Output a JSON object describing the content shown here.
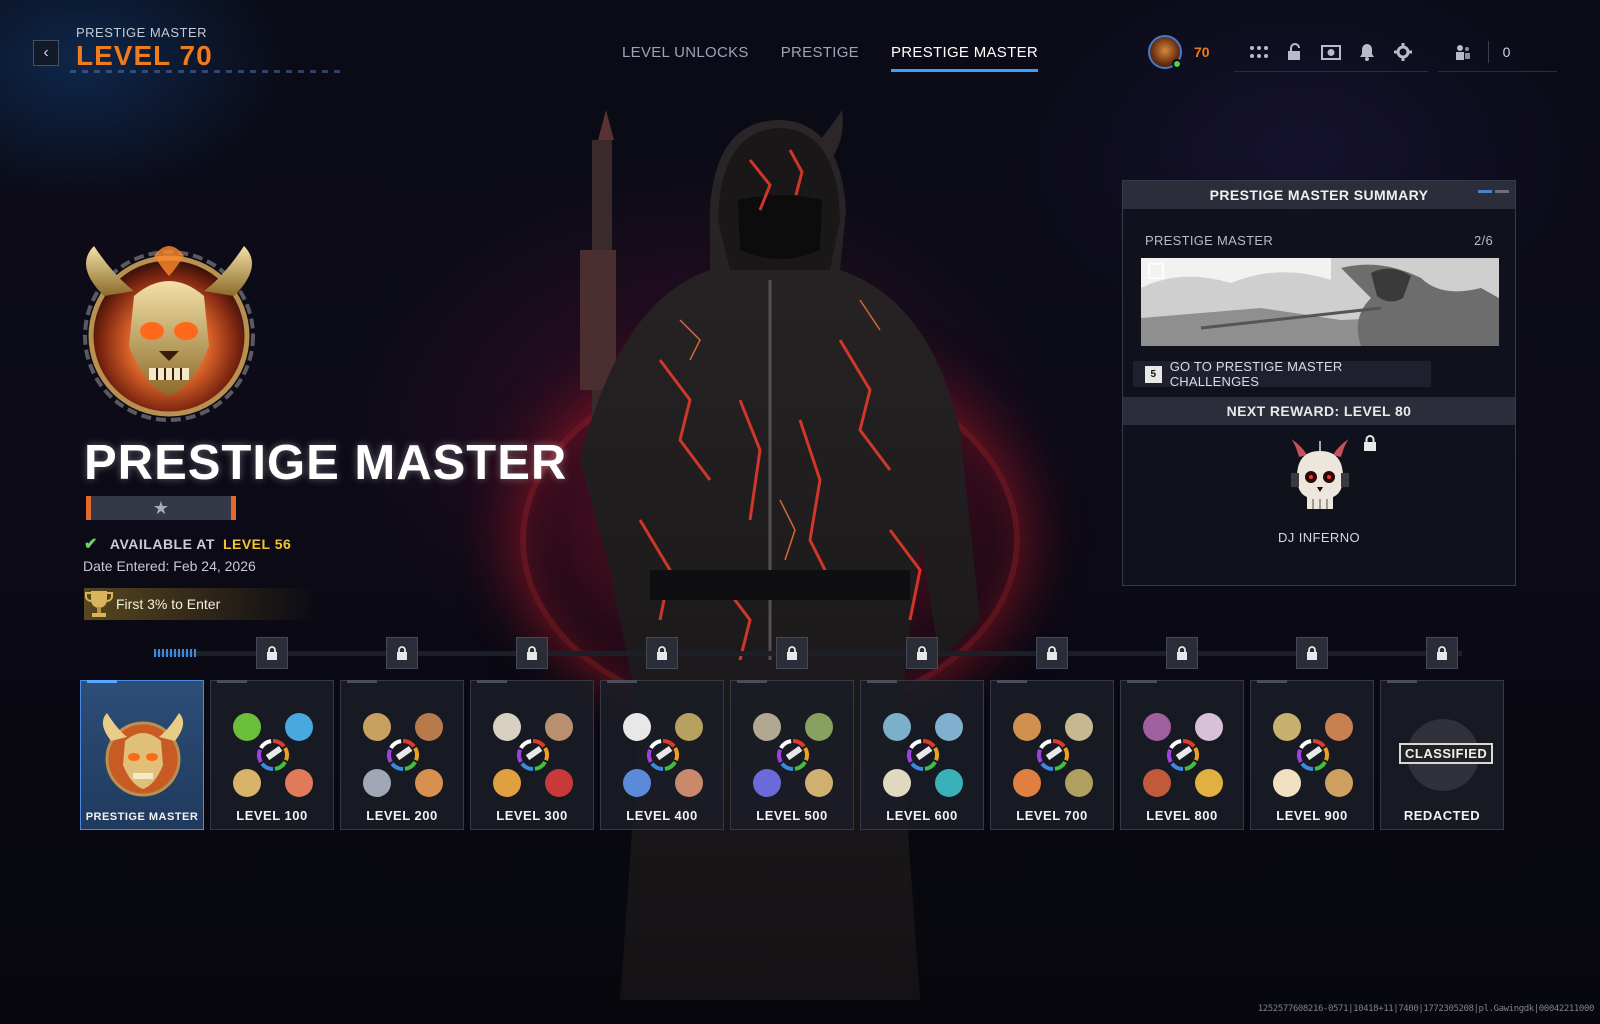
{
  "header": {
    "subtitle": "PRESTIGE MASTER",
    "level": "LEVEL 70"
  },
  "nav": {
    "tabs": [
      "LEVEL UNLOCKS",
      "PRESTIGE",
      "PRESTIGE MASTER"
    ],
    "active": 2
  },
  "player": {
    "level": "70",
    "count": "0"
  },
  "hero": {
    "title": "PRESTIGE MASTER",
    "available_label": "AVAILABLE AT",
    "available_level": "LEVEL 56",
    "date_entered": "Date Entered: Feb 24, 2026",
    "badge": "First 3% to Enter"
  },
  "summary": {
    "title": "PRESTIGE MASTER SUMMARY",
    "row_label": "PRESTIGE MASTER",
    "row_value": "2/6",
    "challenge_key": "5",
    "challenge_label": "GO TO PRESTIGE MASTER CHALLENGES",
    "next_title": "NEXT REWARD: LEVEL 80",
    "reward_name": "DJ INFERNO"
  },
  "cards": [
    {
      "label": "PRESTIGE MASTER"
    },
    {
      "label": "LEVEL 100"
    },
    {
      "label": "LEVEL 200"
    },
    {
      "label": "LEVEL 300"
    },
    {
      "label": "LEVEL 400"
    },
    {
      "label": "LEVEL 500"
    },
    {
      "label": "LEVEL 600"
    },
    {
      "label": "LEVEL 700"
    },
    {
      "label": "LEVEL 800"
    },
    {
      "label": "LEVEL 900"
    },
    {
      "label": "REDACTED"
    }
  ],
  "classified_text": "CLASSIFIED",
  "footer_id": "1252577608216-0571|10418+11|7400|1772305208|pl.Gawingdk|00042211000",
  "colors": {
    "accent": "#f07a1e",
    "highlight": "#f3c531",
    "tab_underline": "#3aa0ff",
    "check": "#6fd45c"
  }
}
